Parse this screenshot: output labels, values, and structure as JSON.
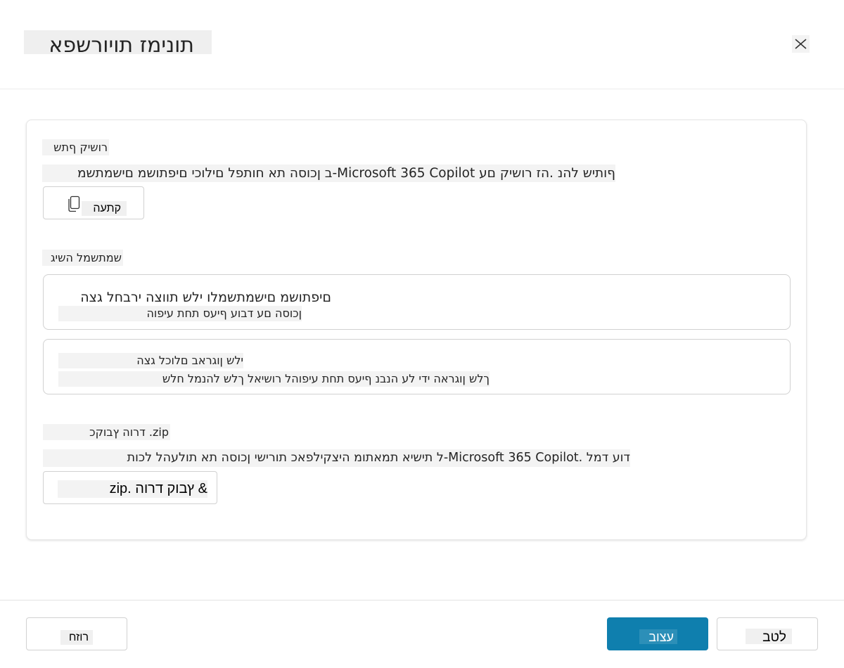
{
  "header": {
    "title": "תונימז תויורשפא"
  },
  "share_link": {
    "label": "רושיק ףתש",
    "description": "ףותיש להנ .הז רושיק םע Microsoft 365 Copilot-ב ןכוסה תא חותפל םילוכי םיפתושמ םישמתשמ",
    "copy_label": "קתעה"
  },
  "access": {
    "label": "שמתשמל השיג",
    "options": [
      {
        "title": "םיפתושמ םישמתשמלו ילש תווצה ירבחל גצה",
        "subtitle": "ןכוסה םע דבוע ףיעס תחת עיפוה"
      },
      {
        "title": "ילש ןוגראב םלוכל גצה",
        "subtitle": "ךלש ןוגראה ידי לע הנבנ ףיעס תחת עיפוהל רושיאל ךלש להנמל חלש"
      }
    ]
  },
  "zip": {
    "label": "zip. דרוה ץבוקכ",
    "description": "דוע דמל .Microsoft 365 Copilot-ל תישיא תמאתומ היצקילפאכ תורישי ןכוסה תא תולעהל לכות",
    "button_label": "& ץבוק דרוה .zip"
  },
  "footer": {
    "back_label": "רוזח",
    "stop_label": "עצוב",
    "cancel_label": "לטב"
  }
}
